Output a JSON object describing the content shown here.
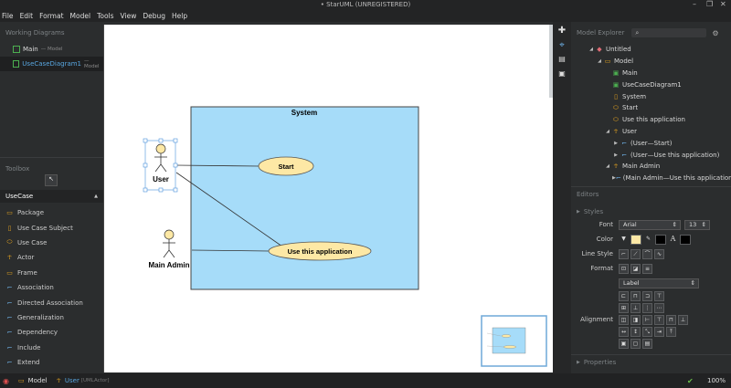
{
  "window": {
    "title": "• StarUML (UNREGISTERED)"
  },
  "menu": [
    "File",
    "Edit",
    "Format",
    "Model",
    "Tools",
    "View",
    "Debug",
    "Help"
  ],
  "working_diagrams": {
    "header": "Working Diagrams",
    "items": [
      {
        "label": "Main",
        "sub": "— Model"
      },
      {
        "label": "UseCaseDiagram1",
        "sub": "— Model"
      }
    ]
  },
  "toolbox": {
    "header": "Toolbox",
    "section": "UseCase",
    "items": [
      "Package",
      "Use Case Subject",
      "Use Case",
      "Actor",
      "Frame",
      "Association",
      "Directed Association",
      "Generalization",
      "Dependency",
      "Include",
      "Extend"
    ]
  },
  "diagram": {
    "system_label": "System",
    "actors": [
      "User",
      "Main Admin"
    ],
    "usecases": [
      "Start",
      "Use this application"
    ]
  },
  "model_explorer": {
    "header": "Model Explorer",
    "tree": [
      {
        "label": "Untitled",
        "level": 0,
        "icon": "project-icon"
      },
      {
        "label": "Model",
        "level": 1,
        "icon": "package-icon"
      },
      {
        "label": "Main",
        "level": 2,
        "icon": "diagram-icon"
      },
      {
        "label": "UseCaseDiagram1",
        "level": 2,
        "icon": "diagram-icon"
      },
      {
        "label": "System",
        "level": 2,
        "icon": "subject-icon"
      },
      {
        "label": "Start",
        "level": 2,
        "icon": "usecase-icon"
      },
      {
        "label": "Use this application",
        "level": 2,
        "icon": "usecase-icon"
      },
      {
        "label": "User",
        "level": 2,
        "icon": "actor-icon"
      },
      {
        "label": "(User—Start)",
        "level": 3,
        "icon": "association-icon"
      },
      {
        "label": "(User—Use this application)",
        "level": 3,
        "icon": "association-icon"
      },
      {
        "label": "Main Admin",
        "level": 2,
        "icon": "actor-icon"
      },
      {
        "label": "(Main Admin—Use this application)",
        "level": 3,
        "icon": "association-icon"
      }
    ]
  },
  "editors": {
    "header": "Editors",
    "styles_label": "Styles",
    "font_label": "Font",
    "font_value": "Arial",
    "font_size": "13",
    "color_label": "Color",
    "line_style_label": "Line Style",
    "format_label": "Format",
    "format_value": "Label",
    "alignment_label": "Alignment",
    "properties_label": "Properties"
  },
  "statusbar": {
    "model": "Model",
    "element": "User",
    "element_type": "[UMLActor]",
    "zoom": "100%"
  },
  "colors": {
    "subject_fill": "#a6dcf9",
    "usecase_fill": "#fde8a5",
    "accent": "#58a6e0"
  }
}
